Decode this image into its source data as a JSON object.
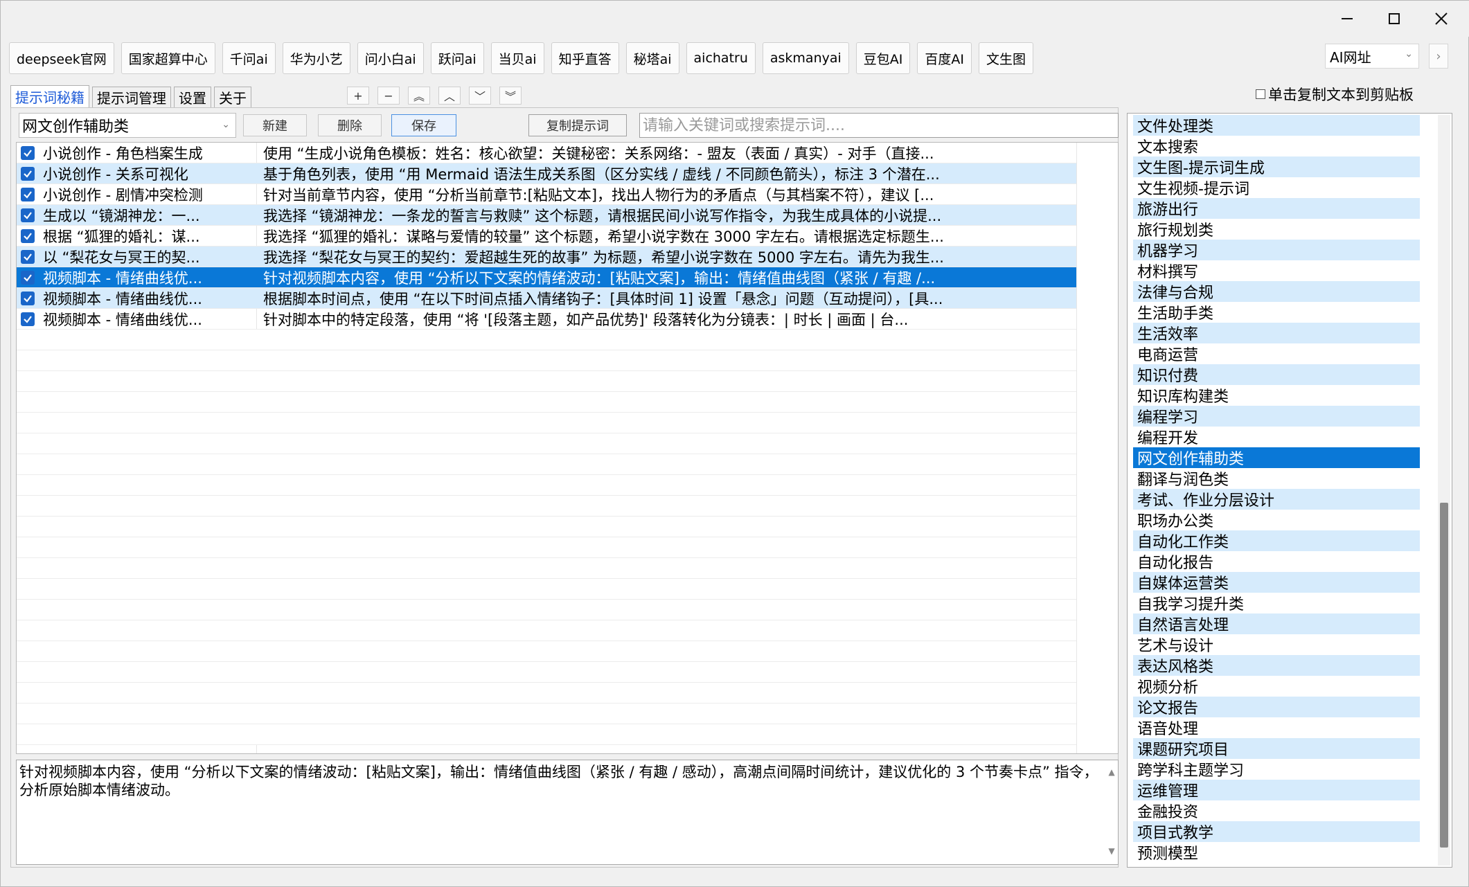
{
  "window": {
    "controls": {
      "minimize": "minimize",
      "maximize": "maximize",
      "close": "close"
    }
  },
  "sites": [
    "deepseek官网",
    "国家超算中心",
    "千问ai",
    "华为小艺",
    "问小白ai",
    "跃问ai",
    "当贝ai",
    "知乎直答",
    "秘塔ai",
    "aichatru",
    "askmanyai",
    "豆包AI",
    "百度AI",
    "文生图"
  ],
  "ai_select": {
    "value": "AI网址",
    "next": "›"
  },
  "tabs": [
    "提示词秘籍",
    "提示词管理",
    "设置",
    "关于"
  ],
  "tab_tools": [
    "+",
    "−",
    "︽",
    "︿",
    "﹀",
    "︾"
  ],
  "copy_option": "单击复制文本到剪贴板",
  "toolbar": {
    "category": "网文创作辅助类",
    "new_label": "新建",
    "delete_label": "删除",
    "save_label": "保存",
    "copy_label": "复制提示词",
    "search_placeholder": "请输入关键词或搜索提示词...."
  },
  "prompts": [
    {
      "name": "小说创作 - 角色档案生成",
      "content": "使用 “生成小说角色模板：姓名：核心欲望：关键秘密：关系网络：- 盟友（表面 / 真实）- 对手（直接..."
    },
    {
      "name": "小说创作 - 关系可视化",
      "content": "基于角色列表，使用 “用 Mermaid 语法生成关系图（区分实线 / 虚线 / 不同颜色箭头），标注 3 个潜在..."
    },
    {
      "name": "小说创作 - 剧情冲突检测",
      "content": "针对当前章节内容，使用 “分析当前章节:[粘贴文本]，找出人物行为的矛盾点（与其档案不符），建议 [..."
    },
    {
      "name": "生成以 “镜湖神龙：一...",
      "content": "我选择 “镜湖神龙：一条龙的誓言与救赎” 这个标题，请根据民间小说写作指令，为我生成具体的小说提..."
    },
    {
      "name": "根据 “狐狸的婚礼：谋...",
      "content": "我选择 “狐狸的婚礼：谋略与爱情的较量” 这个标题，希望小说字数在 3000 字左右。请根据选定标题生..."
    },
    {
      "name": "以 “梨花女与冥王的契...",
      "content": "我选择 “梨花女与冥王的契约：爱超越生死的故事” 为标题，希望小说字数在 5000 字左右。请先为我生..."
    },
    {
      "name": "视频脚本 - 情绪曲线优...",
      "content": "针对视频脚本内容，使用 “分析以下文案的情绪波动：[粘贴文案]，输出：情绪值曲线图（紧张 / 有趣 /..."
    },
    {
      "name": "视频脚本 - 情绪曲线优...",
      "content": "根据脚本时间点，使用 “在以下时间点插入情绪钩子：[具体时间 1] 设置「悬念」问题（互动提问），[具..."
    },
    {
      "name": "视频脚本 - 情绪曲线优...",
      "content": "针对脚本中的特定段落，使用 “将 '[段落主题，如产品优势]' 段落转化为分镜表：| 时长 | 画面 | 台..."
    }
  ],
  "detail_text": "针对视频脚本内容，使用 “分析以下文案的情绪波动：[粘贴文案]，输出：情绪值曲线图（紧张 / 有趣 / 感动），高潮点间隔时间统计，建议优化的 3 个节奏卡点” 指令，分析原始脚本情绪波动。",
  "categories": [
    "文件处理类",
    "文本搜索",
    "文生图-提示词生成",
    "文生视频-提示词",
    "旅游出行",
    "旅行规划类",
    "机器学习",
    "材料撰写",
    "法律与合规",
    "生活助手类",
    "生活效率",
    "电商运营",
    "知识付费",
    "知识库构建类",
    "编程学习",
    "编程开发",
    "网文创作辅助类",
    "翻译与润色类",
    "考试、作业分层设计",
    "职场办公类",
    "自动化工作类",
    "自动化报告",
    "自媒体运营类",
    "自我学习提升类",
    "自然语言处理",
    "艺术与设计",
    "表达风格类",
    "视频分析",
    "论文报告",
    "语音处理",
    "课题研究项目",
    "跨学科主题学习",
    "运维管理",
    "金融投资",
    "项目式教学",
    "预测模型"
  ],
  "selected_category_index": 16,
  "selected_prompt_index": 6,
  "colors": {
    "selection": "#0a78d7",
    "alt_row": "#d6ebfc",
    "tab_active": "#1e5bd8"
  }
}
